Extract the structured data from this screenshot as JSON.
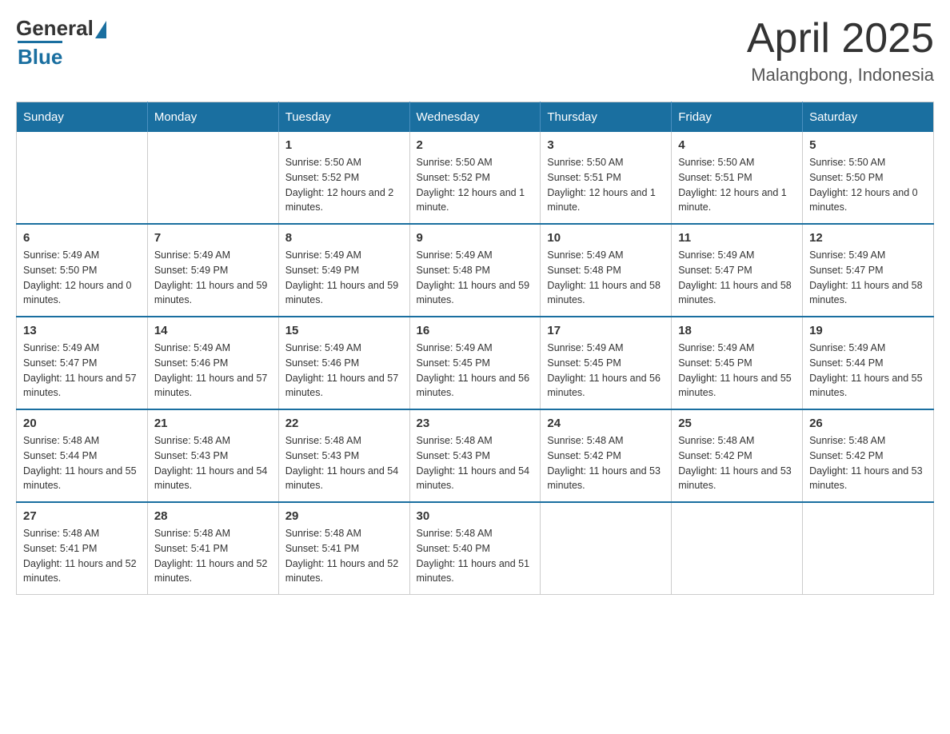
{
  "logo": {
    "general": "General",
    "blue": "Blue"
  },
  "title": {
    "month_year": "April 2025",
    "location": "Malangbong, Indonesia"
  },
  "headers": [
    "Sunday",
    "Monday",
    "Tuesday",
    "Wednesday",
    "Thursday",
    "Friday",
    "Saturday"
  ],
  "weeks": [
    [
      {
        "day": "",
        "sunrise": "",
        "sunset": "",
        "daylight": ""
      },
      {
        "day": "",
        "sunrise": "",
        "sunset": "",
        "daylight": ""
      },
      {
        "day": "1",
        "sunrise": "Sunrise: 5:50 AM",
        "sunset": "Sunset: 5:52 PM",
        "daylight": "Daylight: 12 hours and 2 minutes."
      },
      {
        "day": "2",
        "sunrise": "Sunrise: 5:50 AM",
        "sunset": "Sunset: 5:52 PM",
        "daylight": "Daylight: 12 hours and 1 minute."
      },
      {
        "day": "3",
        "sunrise": "Sunrise: 5:50 AM",
        "sunset": "Sunset: 5:51 PM",
        "daylight": "Daylight: 12 hours and 1 minute."
      },
      {
        "day": "4",
        "sunrise": "Sunrise: 5:50 AM",
        "sunset": "Sunset: 5:51 PM",
        "daylight": "Daylight: 12 hours and 1 minute."
      },
      {
        "day": "5",
        "sunrise": "Sunrise: 5:50 AM",
        "sunset": "Sunset: 5:50 PM",
        "daylight": "Daylight: 12 hours and 0 minutes."
      }
    ],
    [
      {
        "day": "6",
        "sunrise": "Sunrise: 5:49 AM",
        "sunset": "Sunset: 5:50 PM",
        "daylight": "Daylight: 12 hours and 0 minutes."
      },
      {
        "day": "7",
        "sunrise": "Sunrise: 5:49 AM",
        "sunset": "Sunset: 5:49 PM",
        "daylight": "Daylight: 11 hours and 59 minutes."
      },
      {
        "day": "8",
        "sunrise": "Sunrise: 5:49 AM",
        "sunset": "Sunset: 5:49 PM",
        "daylight": "Daylight: 11 hours and 59 minutes."
      },
      {
        "day": "9",
        "sunrise": "Sunrise: 5:49 AM",
        "sunset": "Sunset: 5:48 PM",
        "daylight": "Daylight: 11 hours and 59 minutes."
      },
      {
        "day": "10",
        "sunrise": "Sunrise: 5:49 AM",
        "sunset": "Sunset: 5:48 PM",
        "daylight": "Daylight: 11 hours and 58 minutes."
      },
      {
        "day": "11",
        "sunrise": "Sunrise: 5:49 AM",
        "sunset": "Sunset: 5:47 PM",
        "daylight": "Daylight: 11 hours and 58 minutes."
      },
      {
        "day": "12",
        "sunrise": "Sunrise: 5:49 AM",
        "sunset": "Sunset: 5:47 PM",
        "daylight": "Daylight: 11 hours and 58 minutes."
      }
    ],
    [
      {
        "day": "13",
        "sunrise": "Sunrise: 5:49 AM",
        "sunset": "Sunset: 5:47 PM",
        "daylight": "Daylight: 11 hours and 57 minutes."
      },
      {
        "day": "14",
        "sunrise": "Sunrise: 5:49 AM",
        "sunset": "Sunset: 5:46 PM",
        "daylight": "Daylight: 11 hours and 57 minutes."
      },
      {
        "day": "15",
        "sunrise": "Sunrise: 5:49 AM",
        "sunset": "Sunset: 5:46 PM",
        "daylight": "Daylight: 11 hours and 57 minutes."
      },
      {
        "day": "16",
        "sunrise": "Sunrise: 5:49 AM",
        "sunset": "Sunset: 5:45 PM",
        "daylight": "Daylight: 11 hours and 56 minutes."
      },
      {
        "day": "17",
        "sunrise": "Sunrise: 5:49 AM",
        "sunset": "Sunset: 5:45 PM",
        "daylight": "Daylight: 11 hours and 56 minutes."
      },
      {
        "day": "18",
        "sunrise": "Sunrise: 5:49 AM",
        "sunset": "Sunset: 5:45 PM",
        "daylight": "Daylight: 11 hours and 55 minutes."
      },
      {
        "day": "19",
        "sunrise": "Sunrise: 5:49 AM",
        "sunset": "Sunset: 5:44 PM",
        "daylight": "Daylight: 11 hours and 55 minutes."
      }
    ],
    [
      {
        "day": "20",
        "sunrise": "Sunrise: 5:48 AM",
        "sunset": "Sunset: 5:44 PM",
        "daylight": "Daylight: 11 hours and 55 minutes."
      },
      {
        "day": "21",
        "sunrise": "Sunrise: 5:48 AM",
        "sunset": "Sunset: 5:43 PM",
        "daylight": "Daylight: 11 hours and 54 minutes."
      },
      {
        "day": "22",
        "sunrise": "Sunrise: 5:48 AM",
        "sunset": "Sunset: 5:43 PM",
        "daylight": "Daylight: 11 hours and 54 minutes."
      },
      {
        "day": "23",
        "sunrise": "Sunrise: 5:48 AM",
        "sunset": "Sunset: 5:43 PM",
        "daylight": "Daylight: 11 hours and 54 minutes."
      },
      {
        "day": "24",
        "sunrise": "Sunrise: 5:48 AM",
        "sunset": "Sunset: 5:42 PM",
        "daylight": "Daylight: 11 hours and 53 minutes."
      },
      {
        "day": "25",
        "sunrise": "Sunrise: 5:48 AM",
        "sunset": "Sunset: 5:42 PM",
        "daylight": "Daylight: 11 hours and 53 minutes."
      },
      {
        "day": "26",
        "sunrise": "Sunrise: 5:48 AM",
        "sunset": "Sunset: 5:42 PM",
        "daylight": "Daylight: 11 hours and 53 minutes."
      }
    ],
    [
      {
        "day": "27",
        "sunrise": "Sunrise: 5:48 AM",
        "sunset": "Sunset: 5:41 PM",
        "daylight": "Daylight: 11 hours and 52 minutes."
      },
      {
        "day": "28",
        "sunrise": "Sunrise: 5:48 AM",
        "sunset": "Sunset: 5:41 PM",
        "daylight": "Daylight: 11 hours and 52 minutes."
      },
      {
        "day": "29",
        "sunrise": "Sunrise: 5:48 AM",
        "sunset": "Sunset: 5:41 PM",
        "daylight": "Daylight: 11 hours and 52 minutes."
      },
      {
        "day": "30",
        "sunrise": "Sunrise: 5:48 AM",
        "sunset": "Sunset: 5:40 PM",
        "daylight": "Daylight: 11 hours and 51 minutes."
      },
      {
        "day": "",
        "sunrise": "",
        "sunset": "",
        "daylight": ""
      },
      {
        "day": "",
        "sunrise": "",
        "sunset": "",
        "daylight": ""
      },
      {
        "day": "",
        "sunrise": "",
        "sunset": "",
        "daylight": ""
      }
    ]
  ]
}
